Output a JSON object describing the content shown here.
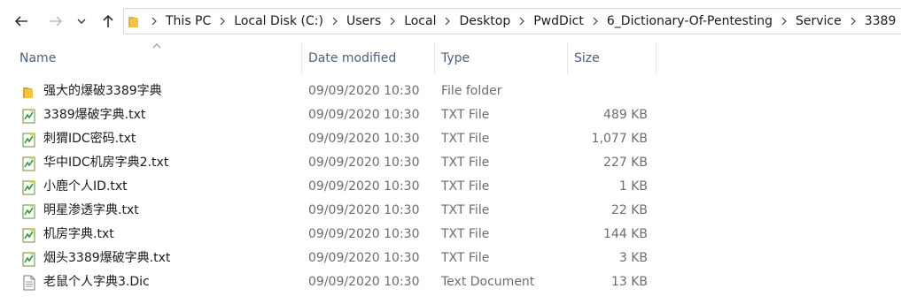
{
  "address_bar": {
    "breadcrumbs": [
      "This PC",
      "Local Disk (C:)",
      "Users",
      "Local",
      "Desktop",
      "PwdDict",
      "6_Dictionary-Of-Pentesting",
      "Service",
      "3389"
    ]
  },
  "columns": {
    "name": "Name",
    "date_modified": "Date modified",
    "type": "Type",
    "size": "Size"
  },
  "files": [
    {
      "name": "强大的爆破3389字典",
      "date": "09/09/2020 10:30",
      "type": "File folder",
      "size": "",
      "icon": "folder-icon"
    },
    {
      "name": "3389爆破字典.txt",
      "date": "09/09/2020 10:30",
      "type": "TXT File",
      "size": "489 KB",
      "icon": "txt-file-icon"
    },
    {
      "name": "刺猬IDC密码.txt",
      "date": "09/09/2020 10:30",
      "type": "TXT File",
      "size": "1,077 KB",
      "icon": "txt-file-icon"
    },
    {
      "name": "华中IDC机房字典2.txt",
      "date": "09/09/2020 10:30",
      "type": "TXT File",
      "size": "227 KB",
      "icon": "txt-file-icon"
    },
    {
      "name": "小鹿个人ID.txt",
      "date": "09/09/2020 10:30",
      "type": "TXT File",
      "size": "1 KB",
      "icon": "txt-file-icon"
    },
    {
      "name": "明星渗透字典.txt",
      "date": "09/09/2020 10:30",
      "type": "TXT File",
      "size": "22 KB",
      "icon": "txt-file-icon"
    },
    {
      "name": "机房字典.txt",
      "date": "09/09/2020 10:30",
      "type": "TXT File",
      "size": "144 KB",
      "icon": "txt-file-icon"
    },
    {
      "name": "烟头3389爆破字典.txt",
      "date": "09/09/2020 10:30",
      "type": "TXT File",
      "size": "3 KB",
      "icon": "txt-file-icon"
    },
    {
      "name": "老鼠个人字典3.Dic",
      "date": "09/09/2020 10:30",
      "type": "Text Document",
      "size": "13 KB",
      "icon": "text-document-icon"
    }
  ],
  "colors": {
    "folder": "#f5c342",
    "header_text": "#4c607a",
    "detail_text": "#6d6d6d",
    "border": "#d9d9d9"
  }
}
